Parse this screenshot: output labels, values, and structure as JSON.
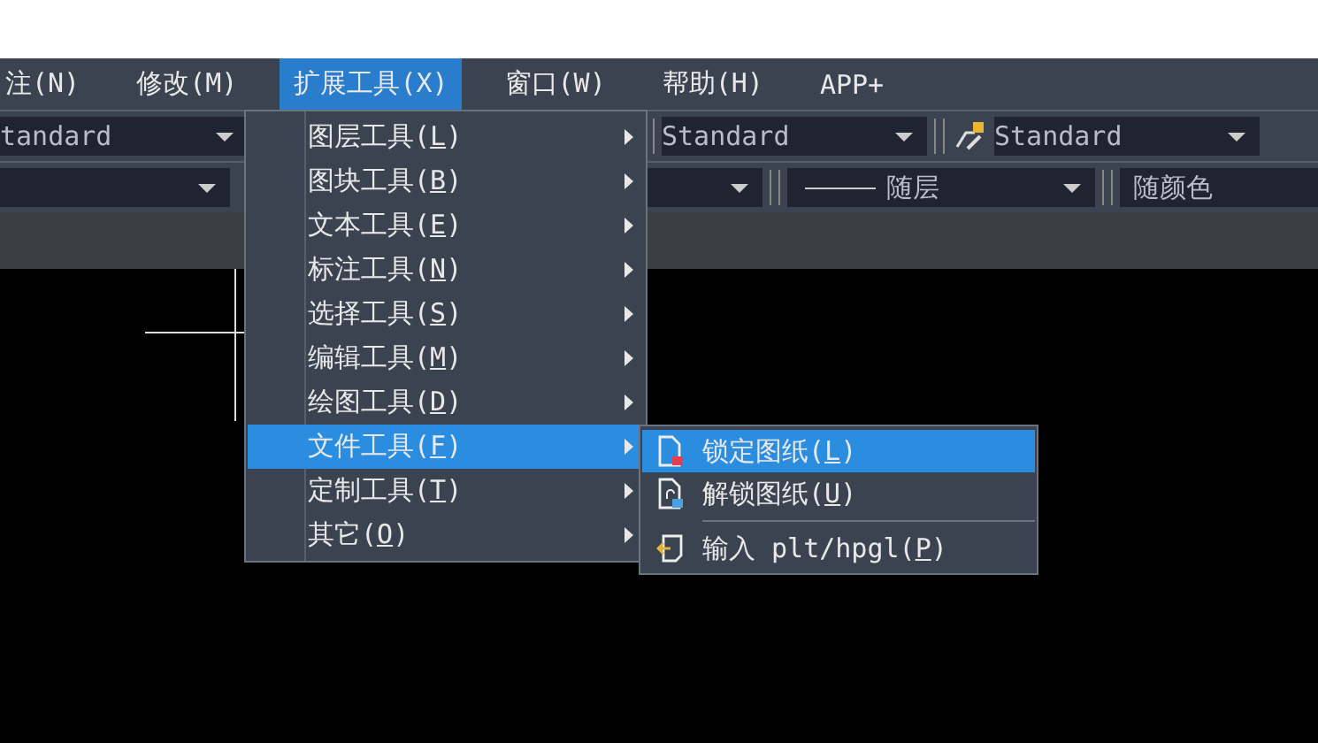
{
  "menu_bar": [
    {
      "label": "注(N)",
      "selected": false
    },
    {
      "label": "修改(M)",
      "selected": false
    },
    {
      "label": "扩展工具(X)",
      "selected": true
    },
    {
      "label": "窗口(W)",
      "selected": false
    },
    {
      "label": "帮助(H)",
      "selected": false
    },
    {
      "label": "APP+",
      "selected": false
    }
  ],
  "toolbar_row_1": [
    {
      "kind": "combo",
      "value": "tandard"
    },
    {
      "kind": "combo",
      "value": "Standard"
    },
    {
      "kind": "icon-combo",
      "value": "Standard"
    }
  ],
  "toolbar_row_2": [
    {
      "kind": "combo"
    },
    {
      "kind": "combo"
    },
    {
      "kind": "line-combo",
      "value": "随层"
    },
    {
      "kind": "text",
      "value": "随颜色"
    }
  ],
  "dropdown_menu": [
    {
      "before": "图层工具(",
      "key": "L",
      "after": ")",
      "selected": false
    },
    {
      "before": "图块工具(",
      "key": "B",
      "after": ")",
      "selected": false
    },
    {
      "before": "文本工具(",
      "key": "E",
      "after": ")",
      "selected": false
    },
    {
      "before": "标注工具(",
      "key": "N",
      "after": ")",
      "selected": false
    },
    {
      "before": "选择工具(",
      "key": "S",
      "after": ")",
      "selected": false
    },
    {
      "before": "编辑工具(",
      "key": "M",
      "after": ")",
      "selected": false
    },
    {
      "before": "绘图工具(",
      "key": "D",
      "after": ")",
      "selected": false
    },
    {
      "before": "文件工具(",
      "key": "F",
      "after": ")",
      "selected": true
    },
    {
      "before": "定制工具(",
      "key": "T",
      "after": ")",
      "selected": false
    },
    {
      "before": "其它(",
      "key": "O",
      "after": ")",
      "selected": false
    }
  ],
  "submenu": [
    {
      "kind": "lock",
      "before": "锁定图纸(",
      "key": "L",
      "after": ")",
      "selected": true,
      "separator_before": false
    },
    {
      "kind": "unlock",
      "before": "解锁图纸(",
      "key": "U",
      "after": ")",
      "selected": false,
      "separator_before": false
    },
    {
      "kind": "import",
      "before": "输入 plt/hpgl(",
      "key": "P",
      "after": ")",
      "selected": false,
      "separator_before": true
    }
  ]
}
